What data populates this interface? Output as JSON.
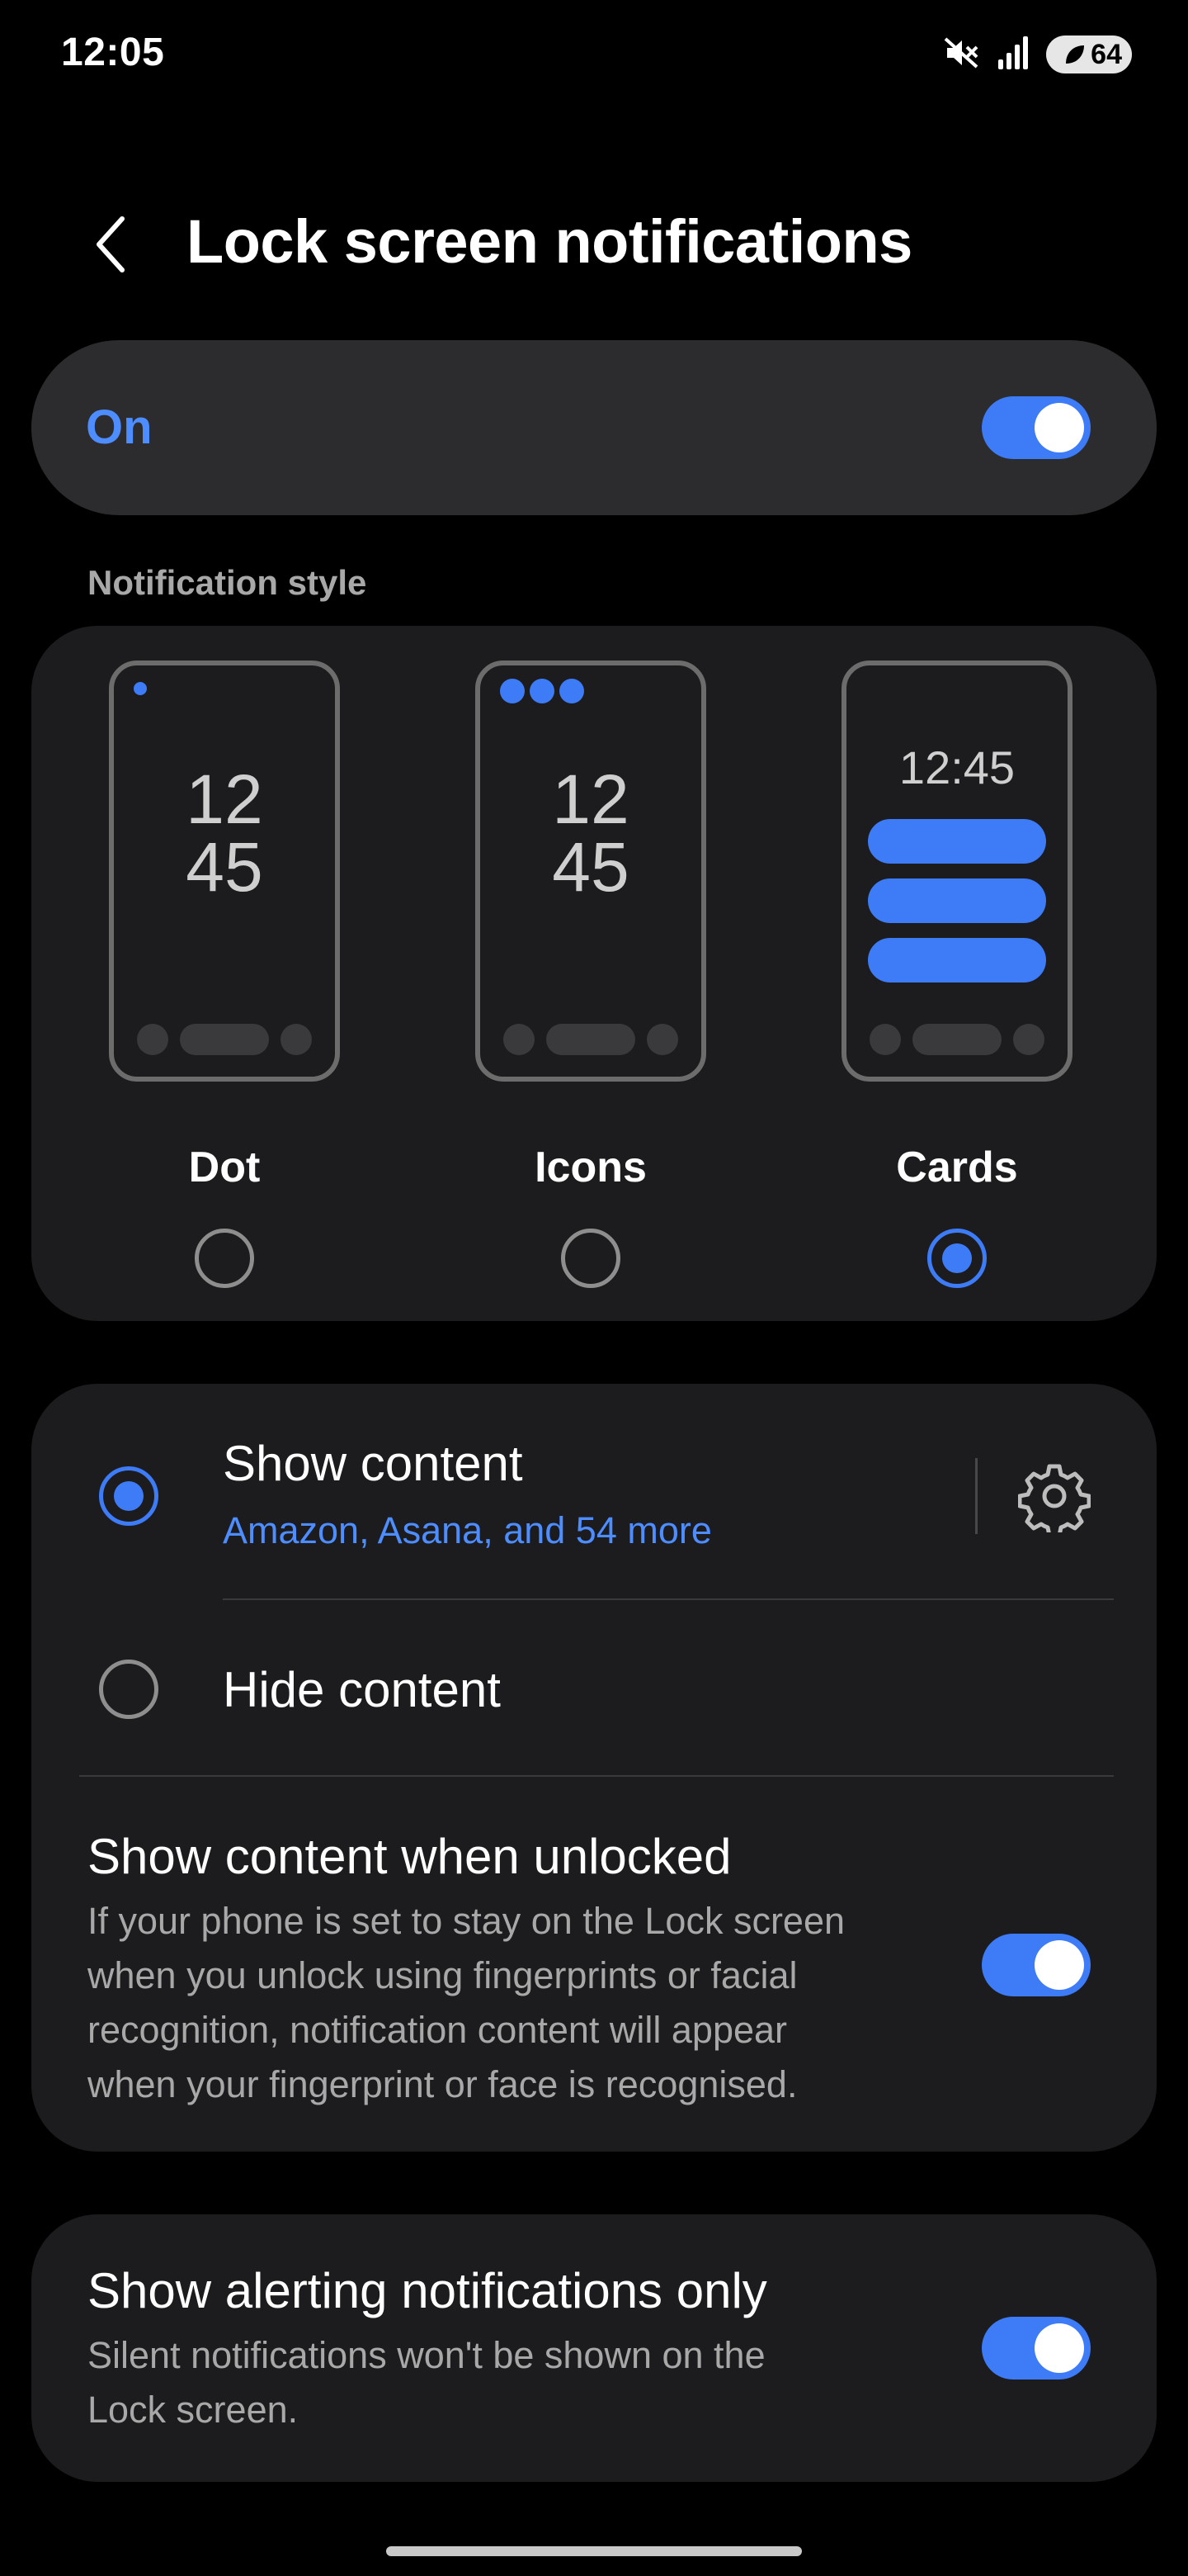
{
  "status_bar": {
    "time": "12:05",
    "battery": "64",
    "icons": [
      "mute-icon",
      "signal-icon",
      "battery-saver-icon"
    ]
  },
  "header": {
    "title": "Lock screen notifications",
    "back_icon": "back-arrow-icon"
  },
  "master_switch": {
    "label": "On",
    "enabled": true
  },
  "notification_style": {
    "section_label": "Notification style",
    "selected": "Cards",
    "options": [
      {
        "label": "Dot",
        "clock_hours": "12",
        "clock_minutes": "45",
        "selected": false
      },
      {
        "label": "Icons",
        "clock_hours": "12",
        "clock_minutes": "45",
        "selected": false
      },
      {
        "label": "Cards",
        "clock": "12:45",
        "selected": true
      }
    ]
  },
  "content": {
    "show_content": {
      "title": "Show content",
      "subtitle": "Amazon, Asana, and 54 more",
      "selected": true
    },
    "hide_content": {
      "title": "Hide content",
      "selected": false
    },
    "show_when_unlocked": {
      "title": "Show content when unlocked",
      "description_lines": [
        "If your phone is set to stay on the Lock screen",
        "when you unlock using fingerprints or facial",
        "recognition, notification content will appear",
        "when your fingerprint or face is recognised."
      ],
      "enabled": true
    }
  },
  "alerting": {
    "title": "Show alerting notifications only",
    "description_lines": [
      "Silent notifications won't be shown on the",
      "Lock screen."
    ],
    "enabled": true
  },
  "colors": {
    "accent": "#3d7bf7",
    "accent_text": "#4d8dff",
    "background": "#000000",
    "card": "#1c1c1e",
    "secondary_text": "#a8a8a8"
  }
}
